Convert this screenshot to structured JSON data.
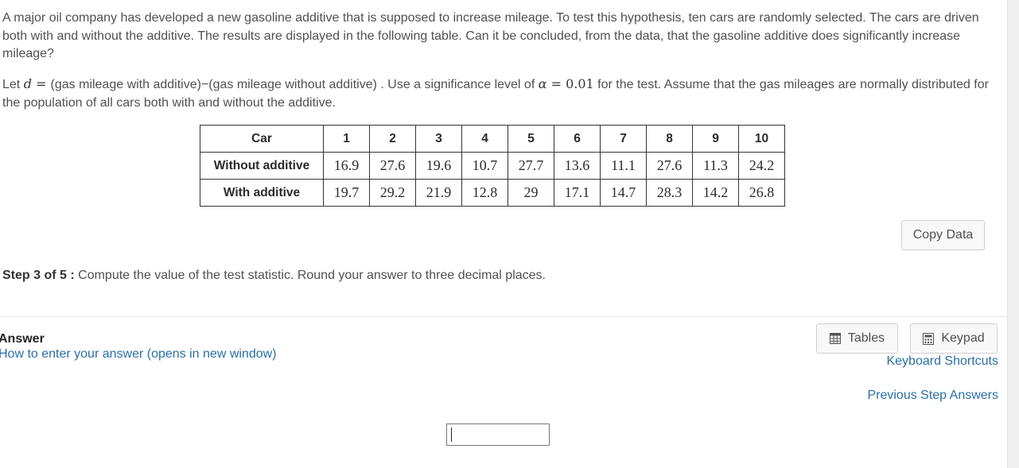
{
  "problem_text": "A major oil company has developed a new gasoline additive that is supposed to increase mileage.  To test this hypothesis, ten cars are randomly selected.  The cars are driven both with and without the additive.  The results are displayed in the following table.  Can it be concluded, from the data, that the gasoline additive does significantly increase mileage?",
  "definition": {
    "prefix": "Let ",
    "var": "d",
    "eq": " = ",
    "expr": "  (gas mileage with additive)−(gas mileage without additive) .  Use a significance level of ",
    "alpha": "α",
    "alpha_eq": " = ",
    "alpha_value": "0.01",
    "suffix": " for the test.  Assume that the gas mileages are normally distributed for the population of all cars both with and without the additive."
  },
  "table": {
    "header_label": "Car",
    "cars": [
      "1",
      "2",
      "3",
      "4",
      "5",
      "6",
      "7",
      "8",
      "9",
      "10"
    ],
    "without_label": "Without additive",
    "without": [
      "16.9",
      "27.6",
      "19.6",
      "10.7",
      "27.7",
      "13.6",
      "11.1",
      "27.6",
      "11.3",
      "24.2"
    ],
    "with_label": "With additive",
    "with": [
      "19.7",
      "29.2",
      "21.9",
      "12.8",
      "29",
      "17.1",
      "14.7",
      "28.3",
      "14.2",
      "26.8"
    ]
  },
  "copy_data_label": "Copy Data",
  "step": {
    "label": "Step 3 of 5 :",
    "text": " Compute the value of the test statistic. Round your answer to three decimal places."
  },
  "answer": {
    "heading": "Answer",
    "howto_link": "How to enter your answer (opens in new window)",
    "input_value": ""
  },
  "tools": {
    "tables_label": "Tables",
    "keypad_label": "Keypad",
    "keyboard_shortcuts_label": "Keyboard Shortcuts",
    "previous_step_answers_label": "Previous Step Answers"
  }
}
